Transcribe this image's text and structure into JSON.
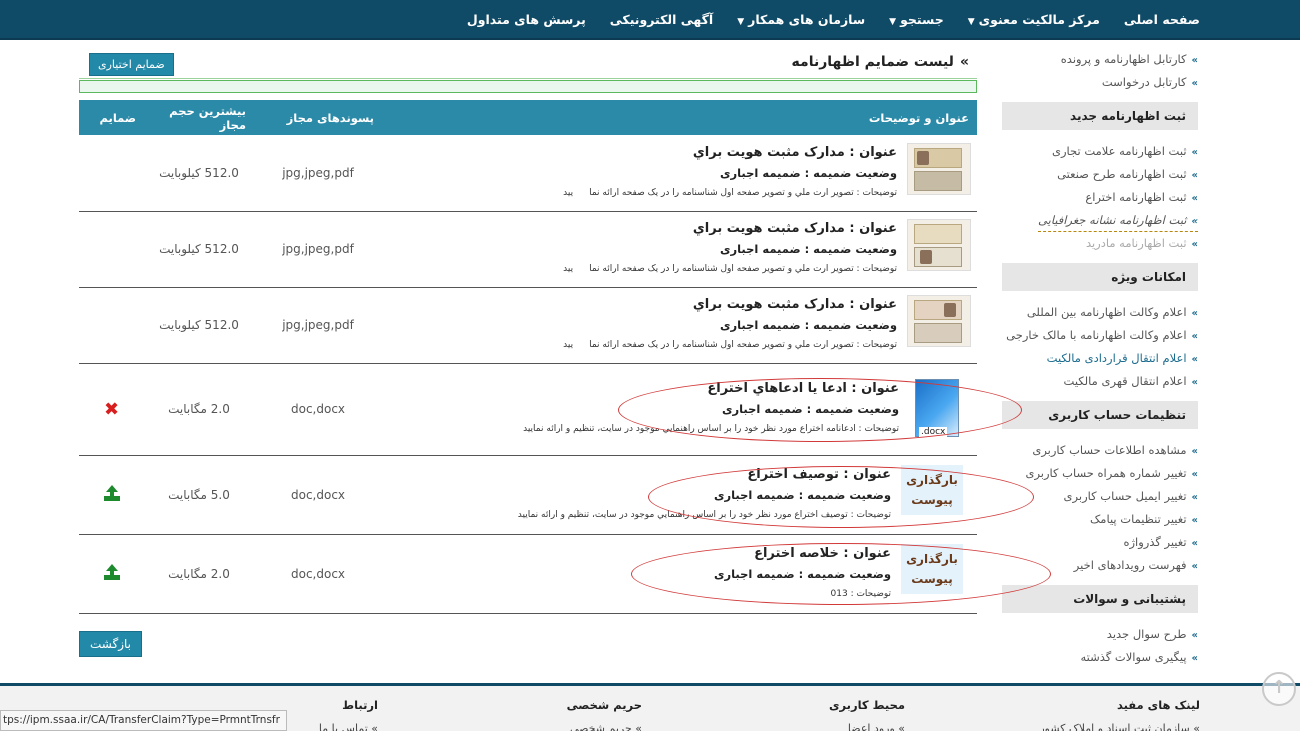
{
  "nav": {
    "items": [
      {
        "label": "صفحه اصلی",
        "dropdown": false
      },
      {
        "label": "مرکز مالکیت معنوی",
        "dropdown": true
      },
      {
        "label": "جستجو",
        "dropdown": true
      },
      {
        "label": "سازمان های همکار",
        "dropdown": true
      },
      {
        "label": "آگهی الکترونیکی",
        "dropdown": false
      },
      {
        "label": "پرسش های متداول",
        "dropdown": false
      }
    ]
  },
  "sidebar": {
    "top_links": [
      "کارتابل اظهارنامه و پرونده",
      "کارتابل درخواست"
    ],
    "sections": [
      {
        "heading": "ثبت اظهارنامه جدید",
        "links": [
          "ثبت اظهارنامه علامت تجاری",
          "ثبت اظهارنامه طرح صنعتی",
          "ثبت اظهارنامه اختراع",
          "ثبت اظهارنامه نشانه جغرافیایی",
          "ثبت اظهارنامه مادرید"
        ]
      },
      {
        "heading": "امکانات ویژه",
        "links": [
          "اعلام وکالت اظهارنامه بین المللی",
          "اعلام وکالت اظهارنامه با مالک خارجی",
          "اعلام انتقال قراردادی مالکیت",
          "اعلام انتقال قهری مالکیت"
        ]
      },
      {
        "heading": "تنظیمات حساب کاربری",
        "links": [
          "مشاهده اطلاعات حساب کاربری",
          "تغییر شماره همراه حساب کاربری",
          "تغییر ایمیل حساب کاربری",
          "تغییر تنظیمات پیامک",
          "تغییر گذرواژه",
          "فهرست رویدادهای اخیر"
        ]
      },
      {
        "heading": "پشتیبانی و سوالات",
        "links": [
          "طرح سوال جدید",
          "پیگیری سوالات گذشته"
        ]
      }
    ]
  },
  "main": {
    "title": "لیست ضمایم اظهارنامه",
    "optional_button": "ضمایم اختیاری",
    "back_button": "بازگشت",
    "table": {
      "headers": [
        "عنوان و توضیحات",
        "پسوندهای مجاز",
        "بیشترین حجم مجاز",
        "ضمایم"
      ],
      "rows": [
        {
          "title": "عنوان : مدارک  مثبت هويت براي",
          "status": "وضعیت ضمیمه : ضمیمه اجباری",
          "desc_a": "توضیحات : تصویر",
          "desc_b": "ارت ملي و تصوير صفحه اول شناسنامه را در يک صفحه ارائه نما",
          "desc_c": "يید",
          "ext": "jpg,jpeg,pdf",
          "size": "512.0 کیلوبایت",
          "action": ""
        },
        {
          "title": "عنوان : مدارک  مثبت هويت براي",
          "status": "وضعیت ضمیمه : ضمیمه اجباری",
          "desc_a": "توضیحات : تصویر",
          "desc_b": "ارت ملي و تصوير صفحه اول شناسنامه را در يک صفحه ارائه نما",
          "desc_c": "يید",
          "ext": "jpg,jpeg,pdf",
          "size": "512.0 کیلوبایت",
          "action": ""
        },
        {
          "title": "عنوان : مدارک  مثبت هويت براي",
          "status": "وضعیت ضمیمه : ضمیمه اجباری",
          "desc_a": "توضیحات : تصویر",
          "desc_b": "ارت ملي و تصوير صفحه اول شناسنامه را در يک صفحه ارائه نما",
          "desc_c": "يید",
          "ext": "jpg,jpeg,pdf",
          "size": "512.0 کیلوبایت",
          "action": ""
        },
        {
          "title": "عنوان : ادعا یا ادعاهاي اختراع",
          "status": "وضعیت ضمیمه : ضمیمه اجباری",
          "desc": "توضیحات : ادعانامه اختراع مورد نظر خود را بر اساس راهنمايي موجود در سايت، تنظیم و ارائه نمایید",
          "ext": "doc,docx",
          "size": "2.0 مگابایت",
          "action": "delete",
          "thumb_label": ".docx"
        },
        {
          "title": "عنوان : توصیف اختراع",
          "status": "وضعیت ضمیمه : ضمیمه اجباری",
          "desc": "توضیحات : توصیف اختراع مورد نظر خود را بر اساس راهنمايي موجود در سايت، تنظیم و ارائه نمایید",
          "ext": "doc,docx",
          "size": "5.0 مگابایت",
          "action": "upload",
          "upload_label": "بارگذاری پیوست"
        },
        {
          "title": "عنوان : خلاصه اختراع",
          "status": "وضعیت ضمیمه : ضمیمه اجباری",
          "desc": "توضیحات : 013",
          "ext": "doc,docx",
          "size": "2.0 مگابایت",
          "action": "upload",
          "upload_label": "بارگذاری پیوست"
        }
      ]
    }
  },
  "footer": {
    "columns": [
      {
        "heading": "لینک های مفید",
        "link": "سازمان ثبت اسناد و املاک کشور"
      },
      {
        "heading": "محیط کاربری",
        "link": "ورود اعضا"
      },
      {
        "heading": "حریم شخصی",
        "link": "حریم شخصی"
      },
      {
        "heading": "ارتباط",
        "link": "تماس با ما"
      }
    ]
  },
  "status_bar": "tps://ipm.ssaa.ir/CA/TransferClaim?Type=PrmntTrnsfr",
  "colors": {
    "nav_bg": "#0f4a66",
    "header_bg": "#2b8aa8",
    "button_bg": "#2389a8",
    "oval": "#d23a3a",
    "delete": "#d81e1e",
    "upload": "#1e8a2e"
  },
  "icons": {
    "delete": "x-icon",
    "upload": "upload-icon",
    "scroll_top": "arrow-up-circle-icon",
    "chevron": "double-chevron-left-icon"
  }
}
